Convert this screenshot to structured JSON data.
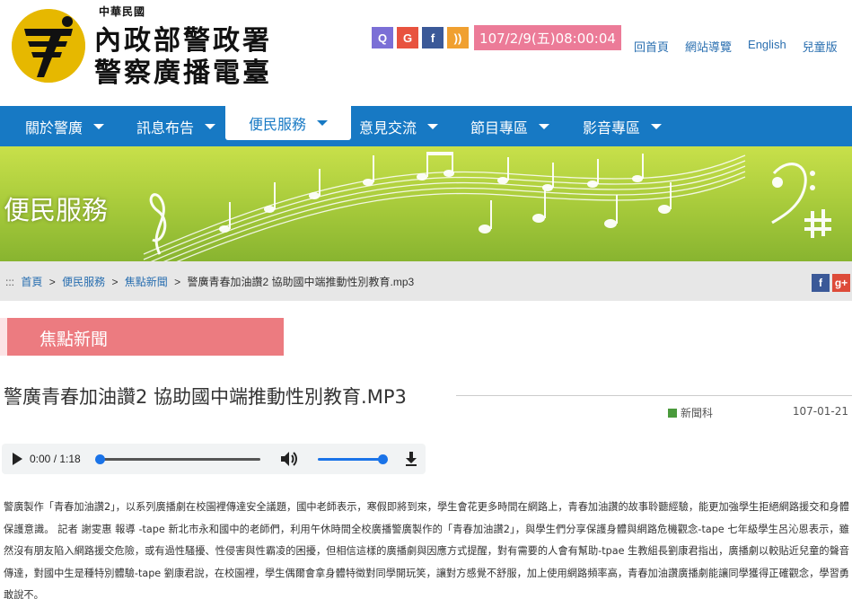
{
  "header": {
    "logo_small": "中華民國",
    "logo_line1": "內政部警政署",
    "logo_line2": "警察廣播電臺",
    "date_display": "107/2/9(五)08:00:04",
    "social_icons": [
      "search-icon",
      "google-icon",
      "facebook-icon",
      "rss-icon"
    ],
    "social_glyphs": {
      "search": "Q",
      "google": "G",
      "facebook": "f",
      "rss": "))"
    },
    "top_links": [
      "回首頁",
      "網站導覽",
      "English",
      "兒童版"
    ]
  },
  "nav": {
    "items": [
      {
        "label": "關於警廣"
      },
      {
        "label": "訊息布告"
      },
      {
        "label": "便民服務",
        "active": true
      },
      {
        "label": "意見交流"
      },
      {
        "label": "節目專區"
      },
      {
        "label": "影音專區"
      }
    ]
  },
  "banner": {
    "title": "便民服務"
  },
  "breadcrumb": {
    "items": [
      "首頁",
      "便民服務",
      "焦點新聞"
    ],
    "current": "警廣青春加油讚2 協助國中端推動性別教育.mp3",
    "separator": ">"
  },
  "share": {
    "facebook_glyph": "f",
    "googleplus_glyph": "g+"
  },
  "section": {
    "title": "焦點新聞"
  },
  "article": {
    "title": "警廣青春加油讚2 協助國中端推動性別教育.MP3",
    "unit": "新聞科",
    "date": "107-01-21",
    "audio": {
      "time": "0:00 / 1:18",
      "progress": 0,
      "volume": 1.0
    },
    "body": "警廣製作「青春加油讚2」，以系列廣播劇在校園裡傳達安全議題，國中老師表示，寒假即將到來，學生會花更多時間在網路上，青春加油讚的故事聆聽經驗，能更加強學生拒絕網路援交和身體保護意識。 記者 謝雯惠 報導 -tape 新北市永和國中的老師們，利用午休時間全校廣播警廣製作的「青春加油讚2」，與學生們分享保護身體與網路危機觀念-tape 七年級學生呂沁恩表示，雖然沒有朋友陷入網路援交危險，或有過性騷擾、性侵害與性霸凌的困擾，但相信這樣的廣播劇與因應方式提醒，對有需要的人會有幫助-tpae 生教組長劉康君指出，廣播劇以較貼近兒童的聲音傳達，對國中生是種特別體驗-tape 劉康君說，在校園裡，學生偶爾會拿身體特徵對同學開玩笑，讓對方感覺不舒服，加上使用網路頻率高，青春加油讚廣播劇能讓同學獲得正確觀念，學習勇敢說不。"
  },
  "colors": {
    "nav_blue": "#1779c4",
    "date_pink": "#ec7b98",
    "section_pink": "#ec7b80",
    "banner_green": "#a5c93a",
    "link_blue": "#2a6fb0"
  }
}
